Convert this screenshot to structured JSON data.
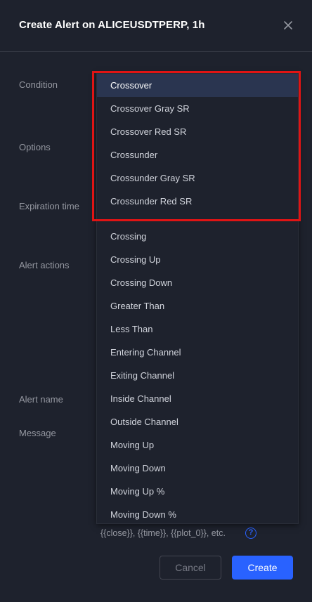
{
  "dialog": {
    "title": "Create Alert on ALICEUSDTPERP, 1h",
    "close_icon": "close-icon"
  },
  "labels": {
    "condition": "Condition",
    "options": "Options",
    "expiration_time": "Expiration time",
    "alert_actions": "Alert actions",
    "alert_name": "Alert name",
    "message": "Message"
  },
  "dropdown": {
    "selected": "Crossover",
    "options": [
      "Crossover",
      "Crossover Gray SR",
      "Crossover Red SR",
      "Crossunder",
      "Crossunder Gray SR",
      "Crossunder Red SR",
      "Crossing",
      "Crossing Up",
      "Crossing Down",
      "Greater Than",
      "Less Than",
      "Entering Channel",
      "Exiting Channel",
      "Inside Channel",
      "Outside Channel",
      "Moving Up",
      "Moving Down",
      "Moving Up %",
      "Moving Down %"
    ]
  },
  "message_hint": "{{close}}, {{time}}, {{plot_0}}, etc.",
  "buttons": {
    "cancel": "Cancel",
    "create": "Create"
  },
  "colors": {
    "background": "#1e222d",
    "accent": "#2962ff",
    "highlight_border": "#e01414",
    "selected_option": "#2a3550"
  }
}
